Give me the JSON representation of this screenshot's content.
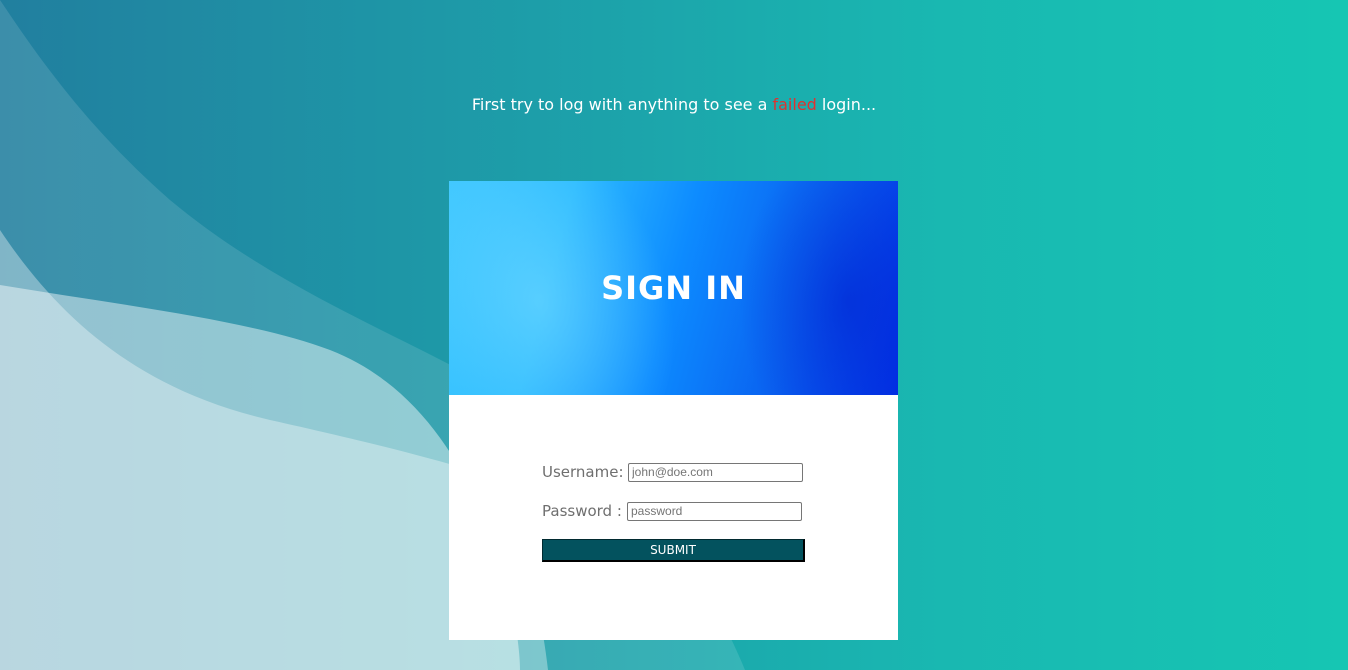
{
  "hint": {
    "prefix": "First try to log with anything to see a ",
    "highlight": "failed",
    "suffix": " login..."
  },
  "card": {
    "title": "SIGN IN"
  },
  "form": {
    "username_label": "Username:",
    "username_placeholder": "john@doe.com",
    "password_label": "Password :",
    "password_placeholder": "password",
    "submit_label": "SUBMIT"
  },
  "colors": {
    "highlight": "#e0312f",
    "submit_bg": "#03525e",
    "background_accent": "#16c6b3"
  }
}
